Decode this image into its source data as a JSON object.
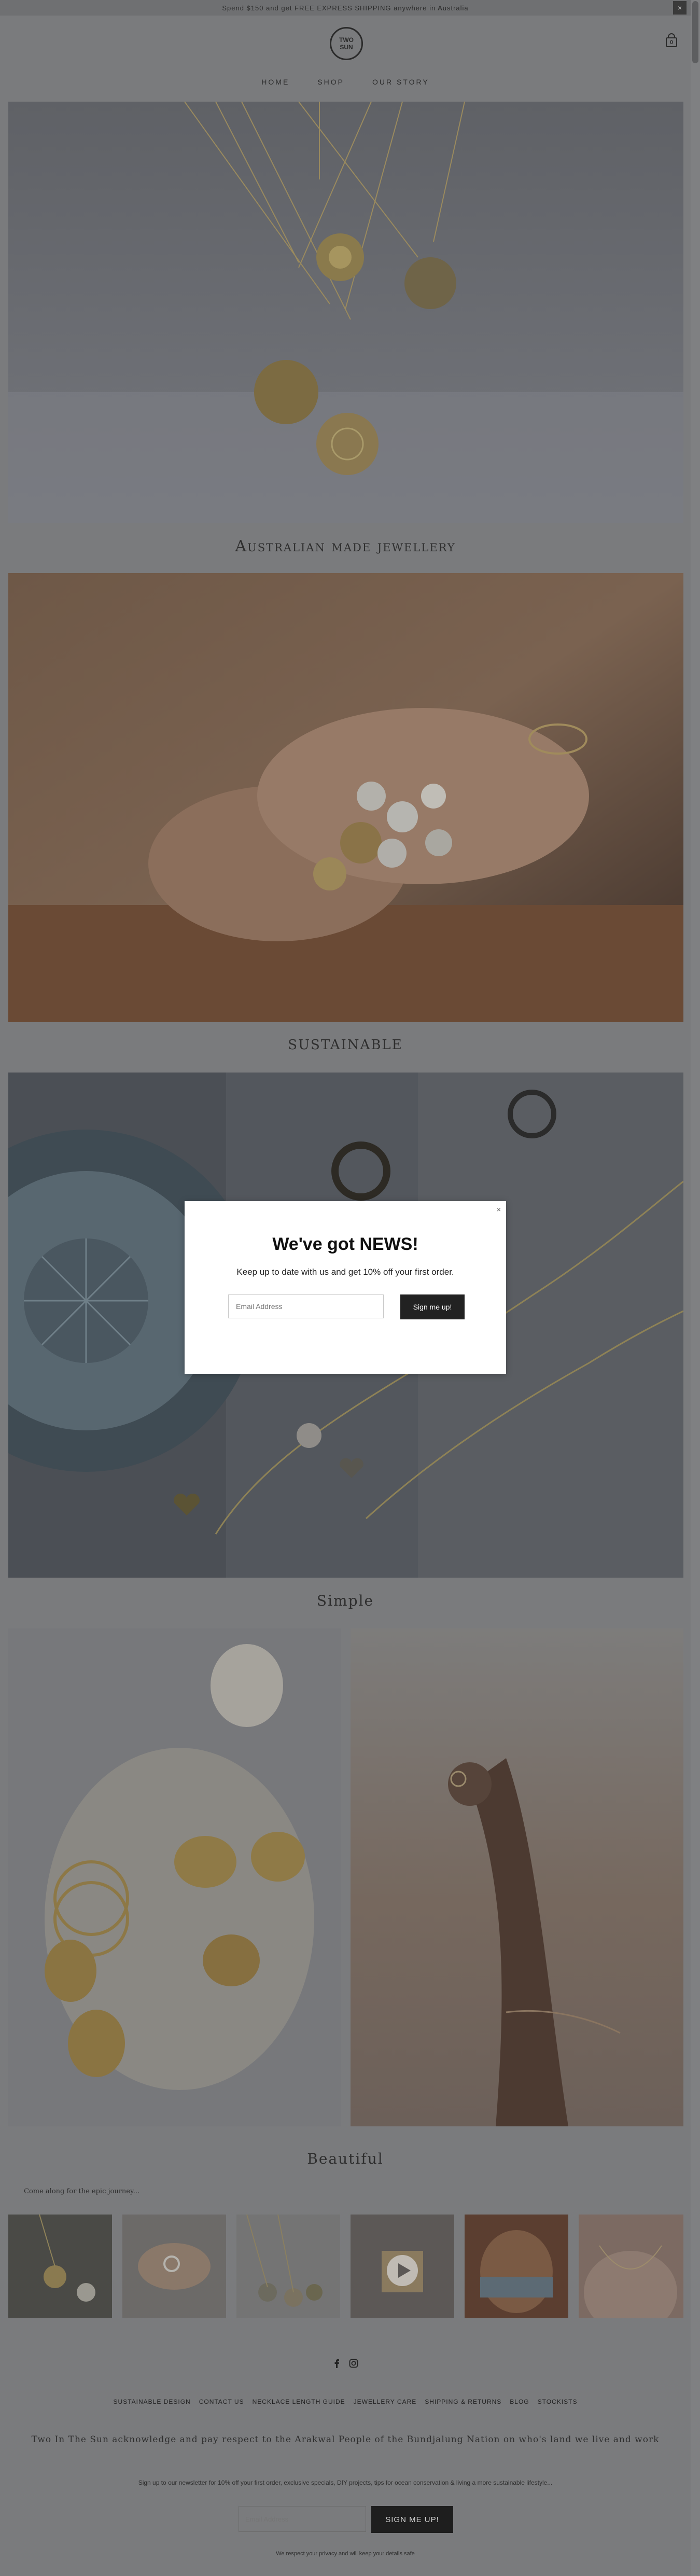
{
  "announcement": {
    "text": "Spend $150 and get FREE EXPRESS SHIPPING anywhere in Australia",
    "close": "×"
  },
  "header": {
    "logo_line1": "TWO",
    "logo_line2": "SUN",
    "cart_count": "0",
    "nav": [
      "HOME",
      "SHOP",
      "OUR STORY"
    ]
  },
  "sections": [
    {
      "title": "Australian made jewellery"
    },
    {
      "title": "SUSTAINABLE"
    },
    {
      "title": "Simple"
    },
    {
      "title": "Beautiful"
    }
  ],
  "popup": {
    "close": "×",
    "title": "We've got NEWS!",
    "subtitle": "Keep up to date with us and get 10% off your first order.",
    "input_placeholder": "Email Address",
    "button": "Sign me up!"
  },
  "instagram": {
    "caption": "Come along for the epic journey..."
  },
  "footer": {
    "links": [
      "SUSTAINABLE DESIGN",
      "CONTACT US",
      "NECKLACE LENGTH GUIDE",
      "JEWELLERY CARE",
      "SHIPPING & RETURNS",
      "BLOG",
      "STOCKISTS"
    ],
    "acknowledgement": "Two In The Sun acknowledge and pay respect to the Arakwal People of the Bundjalung Nation on who's land we live and work",
    "newsletter_text": "Sign up to our newsletter for 10% off your first order, exclusive specials, DIY projects, tips for ocean conservation & living a more sustainable lifestyle...",
    "input_placeholder": "Email Address",
    "button": "SIGN ME UP!",
    "privacy": "We respect your privacy and will keep your details safe"
  }
}
